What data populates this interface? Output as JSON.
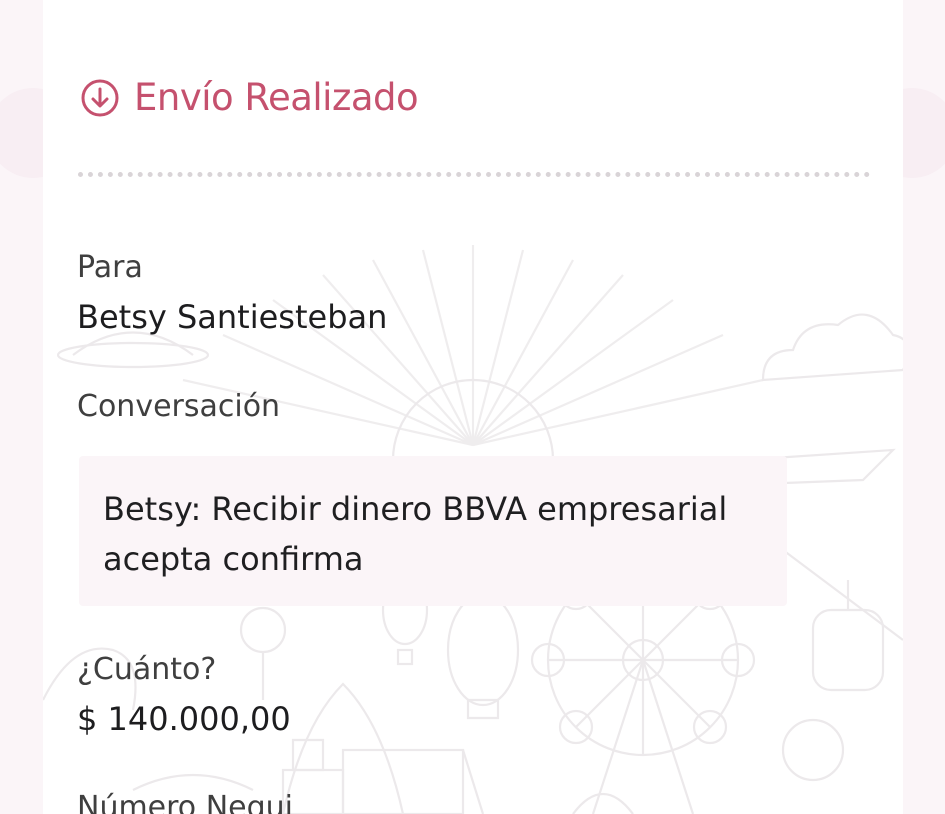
{
  "status": {
    "title": "Envío Realizado",
    "icon": "arrow-down-circle-icon",
    "color": "#c5516e"
  },
  "recipient": {
    "label": "Para",
    "name": "Betsy Santiesteban"
  },
  "conversation": {
    "label": "Conversación",
    "message": "Betsy: Recibir dinero BBVA empresarial acepta confirma"
  },
  "amount": {
    "label": "¿Cuánto?",
    "value": "$ 140.000,00"
  },
  "nequi_number": {
    "label": "Número Nequi"
  }
}
